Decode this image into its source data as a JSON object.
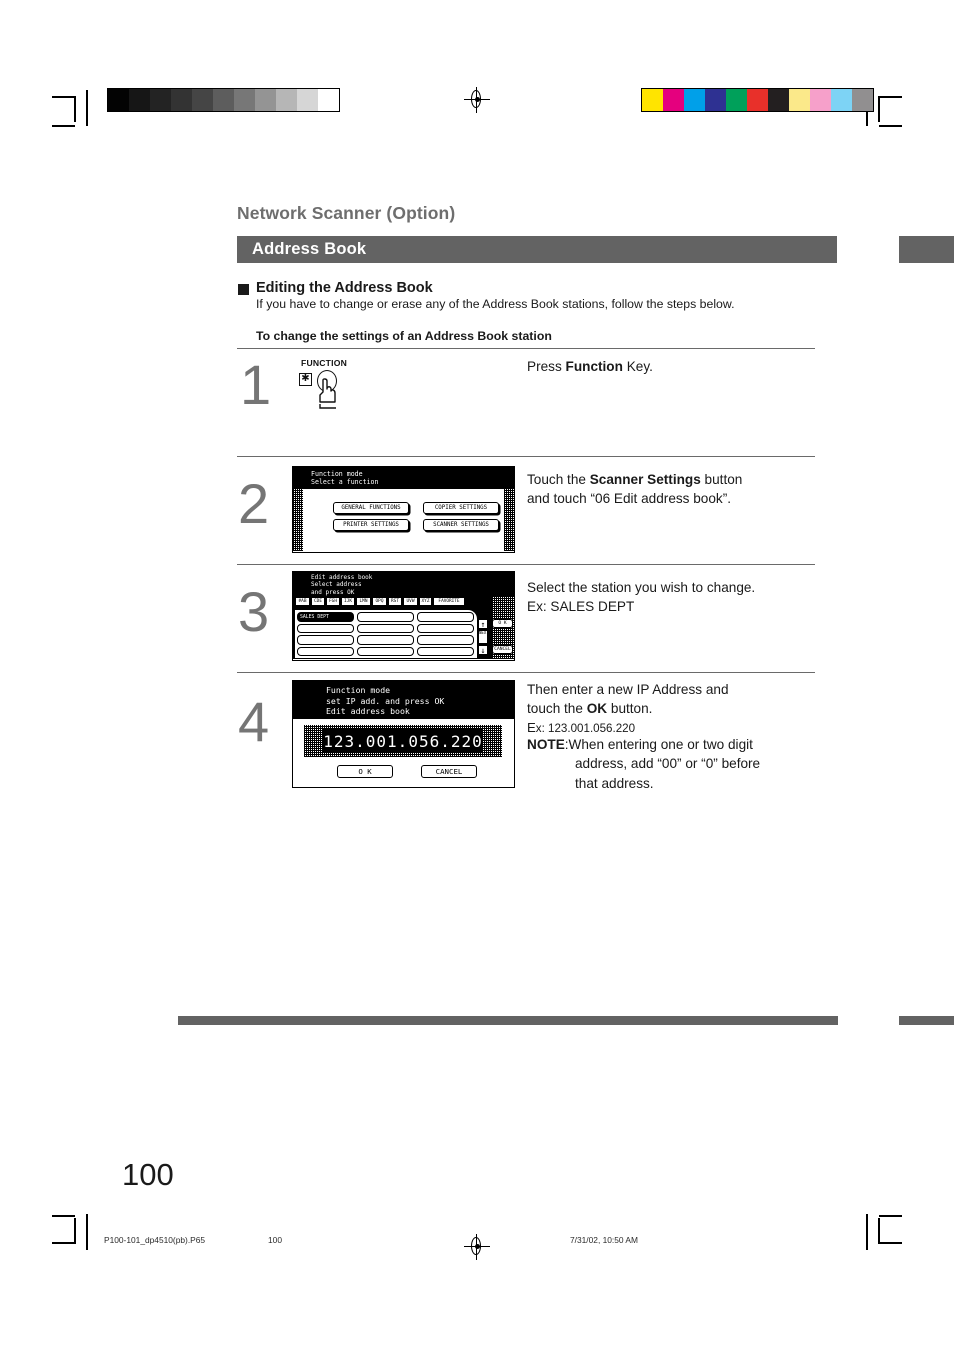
{
  "page": {
    "section_title": "Network Scanner (Option)",
    "banner_label": "Address Book",
    "sub_head": "Editing the Address Book",
    "sub_desc": "If you have to change or erase any of the Address Book stations, follow the steps below.",
    "procedure_head": "To change the settings of an Address Book station",
    "page_number": "100"
  },
  "steps": [
    {
      "number": "1",
      "instruction_html": "Press <b>Function</b> Key.",
      "key_label": "FUNCTION",
      "key_glyph": "✱"
    },
    {
      "number": "2",
      "instruction_html": "Touch the <b>Scanner Settings</b> button<br>and touch “06 Edit address book”."
    },
    {
      "number": "3",
      "instruction_html": "Select the station you wish to change.<br>Ex: SALES DEPT"
    },
    {
      "number": "4",
      "instruction_html": "Then enter a new IP Address and<br>touch the <b>OK</b> button."
    }
  ],
  "step4_extra": {
    "example_prefix": "E",
    "example_rest": "x: 123.001.056.220",
    "note_label": "NOTE",
    "note_line1": ":When entering one or two digit",
    "note_line2": "address, add “00” or “0” before",
    "note_line3": "that address."
  },
  "lcd_step2": {
    "header_line1": "Function mode",
    "header_line2": "Select a function",
    "buttons": [
      "GENERAL FUNCTIONS",
      "COPIER SETTINGS",
      "PRINTER SETTINGS",
      "SCANNER SETTINGS"
    ]
  },
  "lcd_step3": {
    "header_line1": "Edit address book",
    "header_line2": "Select address",
    "header_line3": "and press OK",
    "tabs": [
      "#AB",
      "CDE",
      "FGH",
      "IJK",
      "LMN",
      "OPQ",
      "RST",
      "UVW",
      "XYZ",
      "FAVORITE"
    ],
    "selected_tab": "RST",
    "cells": [
      [
        "SALES DEPT",
        "",
        ""
      ],
      [
        "",
        "",
        ""
      ],
      [
        "",
        "",
        ""
      ],
      [
        "",
        "",
        ""
      ]
    ],
    "selected_cell": "SALES DEPT",
    "scroll_up": "↑",
    "scroll_down": "↓",
    "scroll_label": "NEXT",
    "ok_label": "O K",
    "cancel_label": "CANCEL"
  },
  "lcd_step4": {
    "header_line1": "Function mode",
    "header_line2": "set IP add. and press OK",
    "header_line3": "Edit address book",
    "ip_value": "123.001.056.220",
    "ok_label": "O K",
    "cancel_label": "CANCEL"
  },
  "calibration": {
    "gray_swatches": [
      "#030303",
      "#161616",
      "#232323",
      "#333333",
      "#454545",
      "#5d5d5d",
      "#777777",
      "#949494",
      "#b6b6b6",
      "#d6d6d6",
      "#ffffff"
    ],
    "color_swatches": [
      "#ffe400",
      "#e5007e",
      "#00a0e9",
      "#2e3192",
      "#00a05a",
      "#e8302a",
      "#231f20",
      "#fbe98a",
      "#f6a0ca",
      "#7dd3f5",
      "#918f90"
    ]
  },
  "footer": {
    "file_name": "P100-101_dp4510(pb).P65",
    "page_ref": "100",
    "timestamp": "7/31/02, 10:50 AM"
  }
}
